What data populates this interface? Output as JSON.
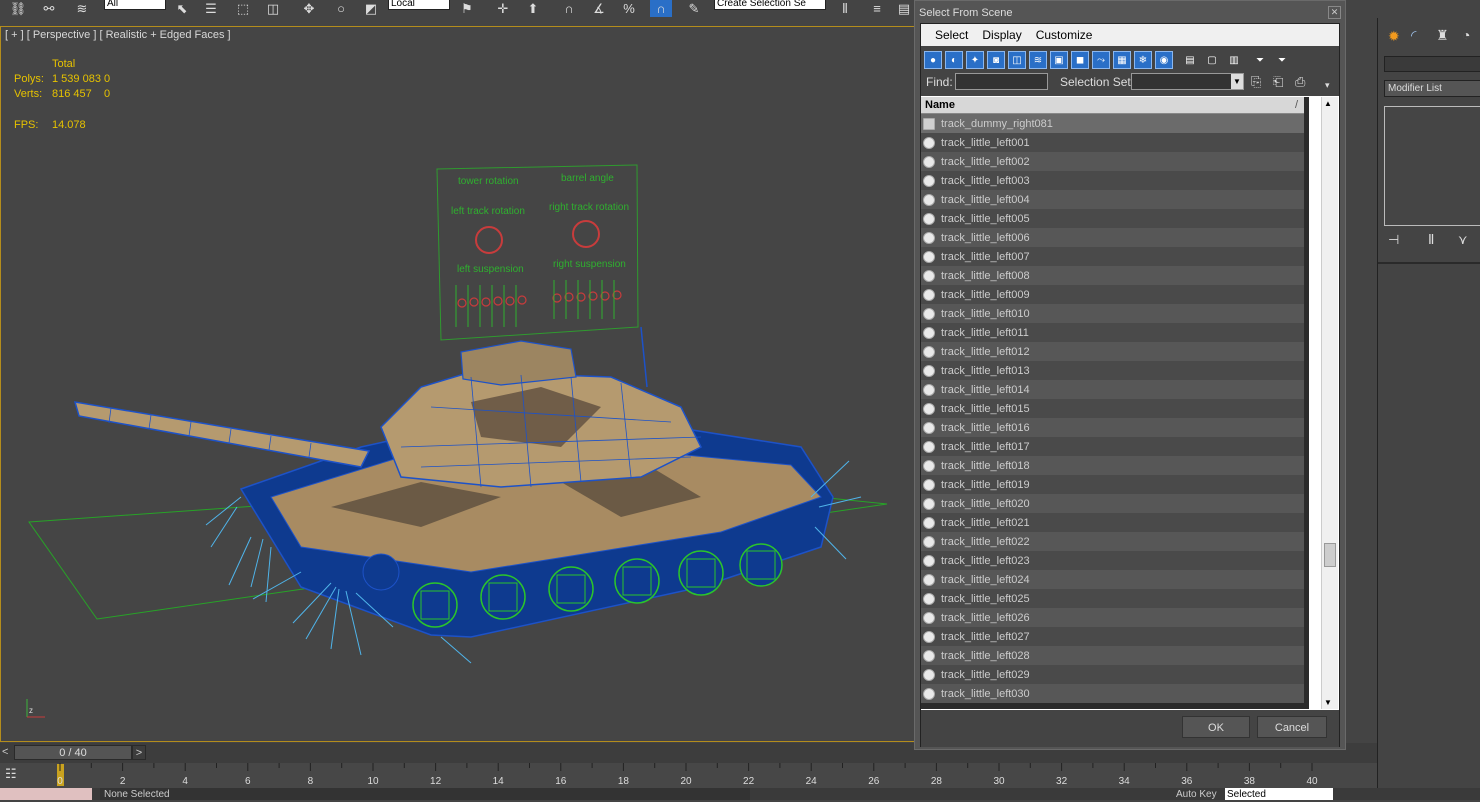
{
  "toolbar": {
    "filter_dropdown": "All",
    "coord_dropdown": "Local",
    "selection_set_dropdown": "Create Selection Se"
  },
  "viewport": {
    "label": "[ + ] [ Perspective ] [ Realistic + Edged Faces ]",
    "stats": {
      "total_label": "Total",
      "polys_label": "Polys:",
      "polys_value": "1 539 083",
      "polys_sel": "0",
      "verts_label": "Verts:",
      "verts_value": "816 457",
      "verts_sel": "0",
      "fps_label": "FPS:",
      "fps_value": "14.078"
    },
    "panel_labels": {
      "tower": "tower rotation",
      "barrel": "barrel angle",
      "left_track": "left track rotation",
      "right_track": "right track rotation",
      "left_susp": "left suspension",
      "right_susp": "right suspension"
    }
  },
  "timeline": {
    "frame_counter": "0 / 40",
    "ticks": [
      "0",
      "2",
      "4",
      "6",
      "8",
      "10",
      "12",
      "14",
      "16",
      "18",
      "20",
      "22",
      "24",
      "26",
      "28",
      "30",
      "32",
      "34",
      "36",
      "38",
      "40"
    ]
  },
  "status": {
    "selection": "None Selected",
    "auto_key": "Auto Key",
    "key_mode": "Selected"
  },
  "command_panel": {
    "modifier_list": "Modifier List"
  },
  "dialog": {
    "title": "Select From Scene",
    "menu": [
      "Select",
      "Display",
      "Customize"
    ],
    "find_label": "Find:",
    "find_value": "",
    "selection_set_label": "Selection Set:",
    "column_name": "Name",
    "rows": [
      "track_dummy_right081",
      "track_little_left001",
      "track_little_left002",
      "track_little_left003",
      "track_little_left004",
      "track_little_left005",
      "track_little_left006",
      "track_little_left007",
      "track_little_left008",
      "track_little_left009",
      "track_little_left010",
      "track_little_left011",
      "track_little_left012",
      "track_little_left013",
      "track_little_left014",
      "track_little_left015",
      "track_little_left016",
      "track_little_left017",
      "track_little_left018",
      "track_little_left019",
      "track_little_left020",
      "track_little_left021",
      "track_little_left022",
      "track_little_left023",
      "track_little_left024",
      "track_little_left025",
      "track_little_left026",
      "track_little_left027",
      "track_little_left028",
      "track_little_left029",
      "track_little_left030"
    ],
    "ok_label": "OK",
    "cancel_label": "Cancel"
  }
}
